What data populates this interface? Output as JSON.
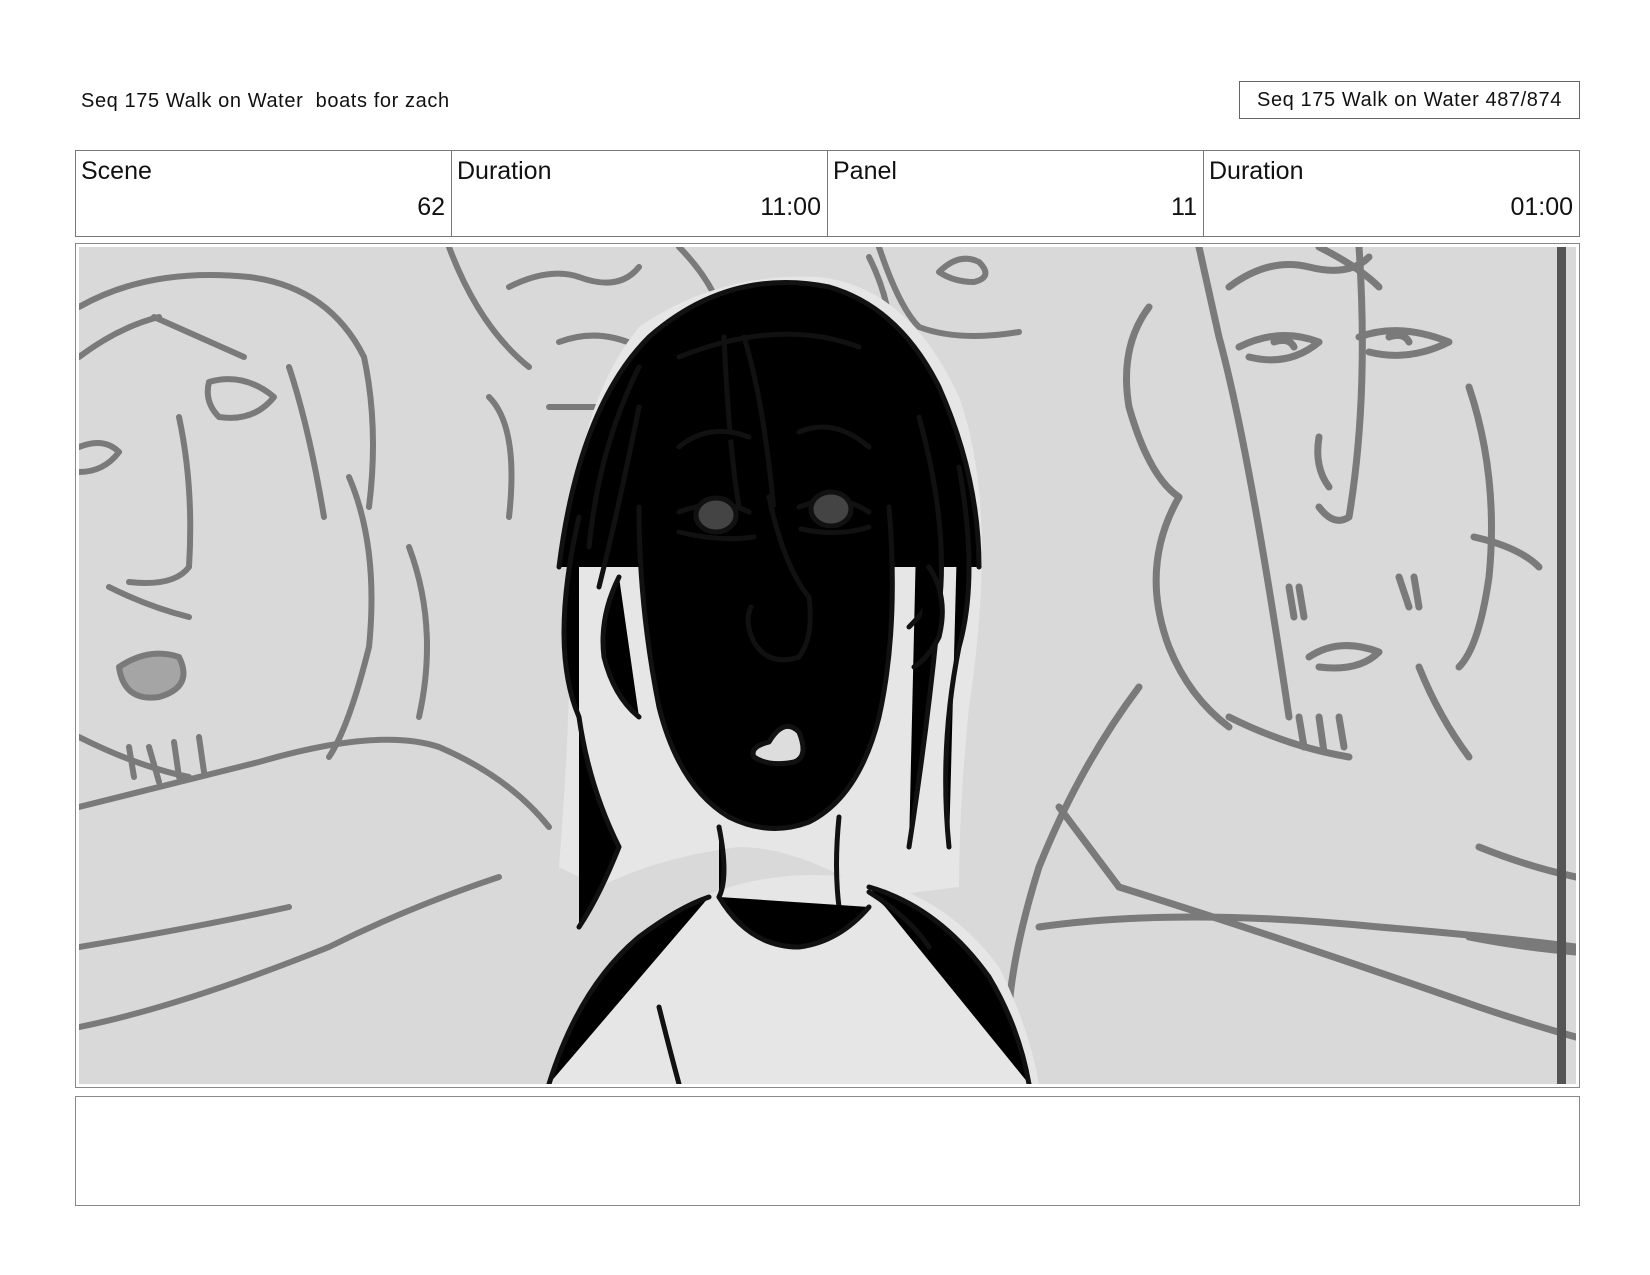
{
  "header": {
    "sequence_title": "Seq 175 Walk on Water  boats for zach",
    "page_counter": "Seq 175 Walk on Water 487/874"
  },
  "info": {
    "scene_label": "Scene",
    "scene_value": "62",
    "scene_duration_label": "Duration",
    "scene_duration_value": "11:00",
    "panel_label": "Panel",
    "panel_value": "11",
    "panel_duration_label": "Duration",
    "panel_duration_value": "01:00"
  },
  "notes": {
    "text": ""
  },
  "colors": {
    "ink": "#111111",
    "background_ink": "#7a7a7a",
    "panel_fill": "#d9d9d9",
    "figure_fill": "#e6e6e6"
  }
}
